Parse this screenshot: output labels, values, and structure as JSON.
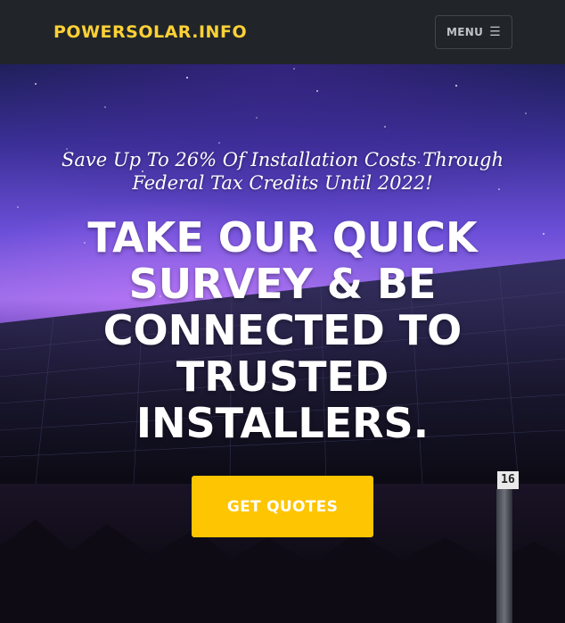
{
  "navbar": {
    "brand": "POWERSOLAR.INFO",
    "menu_label": "MENU",
    "menu_icon": "hamburger-icon"
  },
  "hero": {
    "subheading": "Save Up To 26% Of Installation Costs Through Federal Tax Credits Until 2022!",
    "heading": "TAKE OUR QUICK SURVEY & BE CONNECTED TO TRUSTED INSTALLERS.",
    "cta_label": "GET QUOTES",
    "post_label": "16"
  },
  "colors": {
    "navbar_bg": "#212529",
    "brand": "#fed136",
    "cta_bg": "#fec503",
    "text": "#ffffff"
  }
}
